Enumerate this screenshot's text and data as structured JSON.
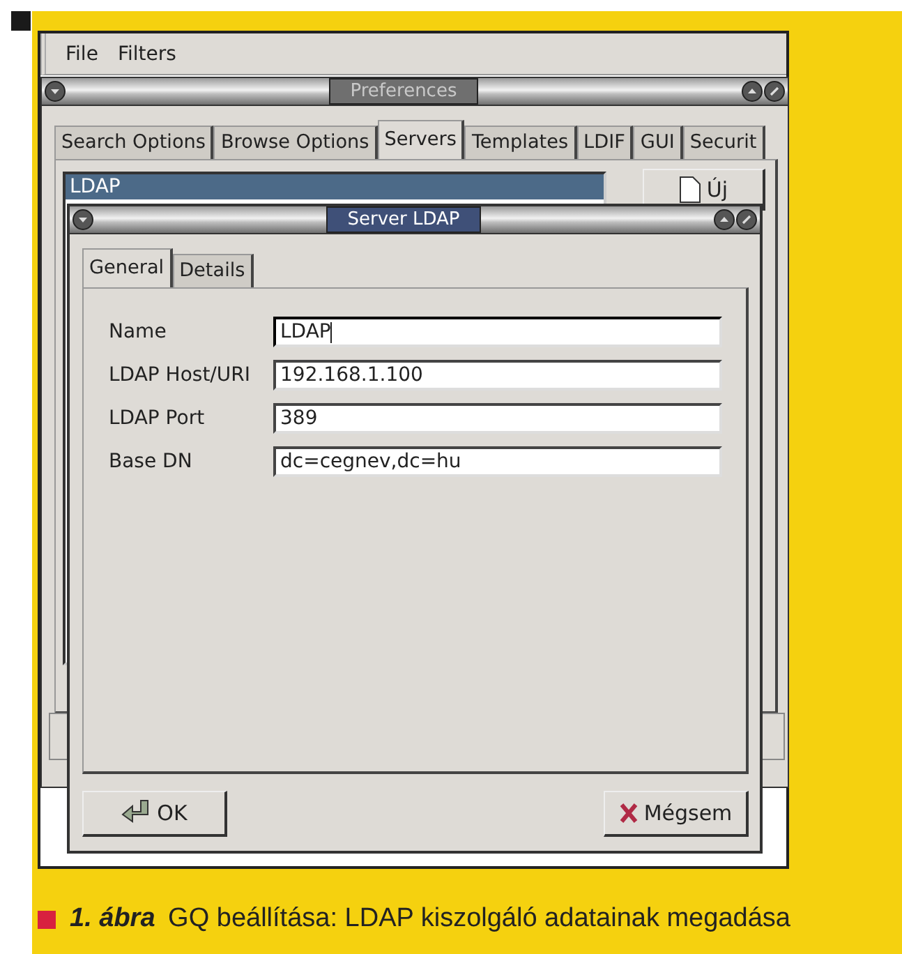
{
  "menu": [
    {
      "label": "File"
    },
    {
      "label": "Filters"
    }
  ],
  "preferences": {
    "title": "Preferences",
    "active": false,
    "tabs": [
      {
        "label": "Search Options",
        "selected": false
      },
      {
        "label": "Browse Options",
        "selected": false
      },
      {
        "label": "Servers",
        "selected": true
      },
      {
        "label": "Templates",
        "selected": false
      },
      {
        "label": "LDIF",
        "selected": false
      },
      {
        "label": "GUI",
        "selected": false
      },
      {
        "label": "Securit",
        "selected": false
      }
    ],
    "servers": [
      {
        "name": "LDAP",
        "selected": true
      }
    ],
    "new_button": "Új"
  },
  "dialog": {
    "title": "Server LDAP",
    "active": true,
    "tabs": [
      {
        "label": "General",
        "selected": true
      },
      {
        "label": "Details",
        "selected": false
      }
    ],
    "fields": [
      {
        "label": "Name",
        "value": "LDAP",
        "focused": true
      },
      {
        "label": "LDAP Host/URI",
        "value": "192.168.1.100",
        "focused": false
      },
      {
        "label": "LDAP Port",
        "value": "389",
        "focused": false
      },
      {
        "label": "Base DN",
        "value": "dc=cegnev,dc=hu",
        "focused": false
      }
    ],
    "buttons": [
      {
        "label": "OK",
        "kind": "ok"
      },
      {
        "label": "Mégsem",
        "kind": "cancel"
      }
    ]
  },
  "caption": {
    "number": "1. ábra",
    "text": "GQ beállítása: LDAP kiszolgáló adatainak megadása"
  }
}
